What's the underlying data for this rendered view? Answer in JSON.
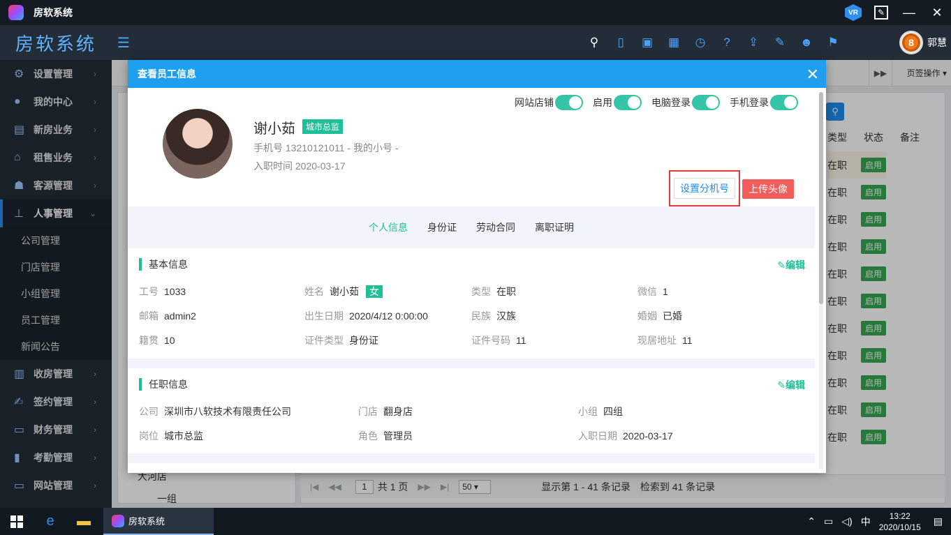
{
  "window": {
    "title": "房软系统"
  },
  "header": {
    "brand": "房软系统",
    "user_name": "郭慧",
    "user_avatar_text": "8"
  },
  "sidebar": {
    "items": [
      {
        "label": "设置管理",
        "icon": "gear-icon"
      },
      {
        "label": "我的中心",
        "icon": "user-icon"
      },
      {
        "label": "新房业务",
        "icon": "building-icon"
      },
      {
        "label": "租售业务",
        "icon": "home-icon"
      },
      {
        "label": "客源管理",
        "icon": "customer-icon"
      },
      {
        "label": "人事管理",
        "icon": "org-icon"
      },
      {
        "label": "收房管理",
        "icon": "house-icon"
      },
      {
        "label": "签约管理",
        "icon": "contract-icon"
      },
      {
        "label": "财务管理",
        "icon": "wallet-icon"
      },
      {
        "label": "考勤管理",
        "icon": "chart-icon"
      },
      {
        "label": "网站管理",
        "icon": "monitor-icon"
      }
    ],
    "subitems": [
      "公司管理",
      "门店管理",
      "小组管理",
      "员工管理",
      "新闻公告"
    ]
  },
  "background": {
    "tab_ops": "页签操作",
    "tree": {
      "node1": "大河店",
      "node2": "一组"
    },
    "grid": {
      "headers": [
        "类型",
        "状态",
        "备注"
      ],
      "rows": [
        {
          "type": "在职",
          "state": "启用"
        },
        {
          "type": "在职",
          "state": "启用"
        },
        {
          "type": "在职",
          "state": "启用"
        },
        {
          "type": "在职",
          "state": "启用"
        },
        {
          "type": "在职",
          "state": "启用"
        },
        {
          "type": "在职",
          "state": "启用"
        },
        {
          "type": "在职",
          "state": "启用"
        },
        {
          "type": "在职",
          "state": "启用"
        },
        {
          "type": "在职",
          "state": "启用"
        },
        {
          "type": "在职",
          "state": "启用"
        },
        {
          "type": "在职",
          "state": "启用"
        },
        {
          "type": "在职",
          "state": "启用"
        }
      ]
    },
    "pager": {
      "page": "1",
      "total_pages": "共 1 页",
      "page_size": "50",
      "summary": "显示第 1 - 41 条记录",
      "found": "检索到 41 条记录"
    }
  },
  "modal": {
    "title": "查看员工信息",
    "name": "谢小茹",
    "role": "城市总监",
    "phone": "手机号 13210121011 - 我的小号 -",
    "join_date": "入职时间 2020-03-17",
    "toggles": [
      "网站店铺",
      "启用",
      "电脑登录",
      "手机登录"
    ],
    "btn_extension": "设置分机号",
    "btn_upload": "上传头像",
    "tabs": [
      "个人信息",
      "身份证",
      "劳动合同",
      "离职证明"
    ],
    "basic": {
      "title": "基本信息",
      "edit": "编辑",
      "fields": [
        {
          "label": "工号",
          "value": "1033"
        },
        {
          "label": "姓名",
          "value": "谢小茹",
          "tag": "女"
        },
        {
          "label": "类型",
          "value": "在职"
        },
        {
          "label": "微信",
          "value": "1"
        },
        {
          "label": "邮箱",
          "value": "admin2"
        },
        {
          "label": "出生日期",
          "value": "2020/4/12 0:00:00"
        },
        {
          "label": "民族",
          "value": "汉族"
        },
        {
          "label": "婚姻",
          "value": "已婚"
        },
        {
          "label": "籍贯",
          "value": "10"
        },
        {
          "label": "证件类型",
          "value": "身份证"
        },
        {
          "label": "证件号码",
          "value": "11"
        },
        {
          "label": "现居地址",
          "value": "11"
        }
      ]
    },
    "job": {
      "title": "任职信息",
      "edit": "编辑",
      "fields": [
        {
          "label": "公司",
          "value": "深圳市八软技术有限责任公司"
        },
        {
          "label": "门店",
          "value": "翻身店"
        },
        {
          "label": "小组",
          "value": "四组"
        },
        {
          "label": "岗位",
          "value": "城市总监"
        },
        {
          "label": "角色",
          "value": "管理员"
        },
        {
          "label": "入职日期",
          "value": "2020-03-17"
        }
      ]
    }
  },
  "taskbar": {
    "app_label": "房软系统",
    "ime": "中",
    "time": "13:22",
    "date": "2020/10/15"
  },
  "colors": {
    "accent": "#1f9ff0",
    "green": "#1fbf97",
    "danger": "#f15c5c"
  }
}
